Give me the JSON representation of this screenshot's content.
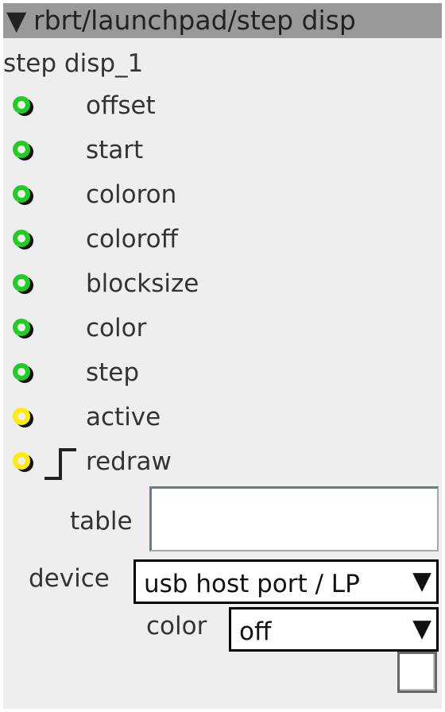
{
  "header": {
    "collapse_glyph": "▼",
    "title": "rbrt/launchpad/step disp"
  },
  "object_name": "step disp_1",
  "ports": [
    {
      "label": "offset",
      "status_color": "#22cc22"
    },
    {
      "label": "start",
      "status_color": "#22cc22"
    },
    {
      "label": "coloron",
      "status_color": "#22cc22"
    },
    {
      "label": "coloroff",
      "status_color": "#22cc22"
    },
    {
      "label": "blocksize",
      "status_color": "#22cc22"
    },
    {
      "label": "color",
      "status_color": "#22cc22"
    },
    {
      "label": "step",
      "status_color": "#22cc22"
    },
    {
      "label": "active",
      "status_color": "#ffee00"
    },
    {
      "label": "redraw",
      "status_color": "#ffee00",
      "icon": "step-function-icon"
    }
  ],
  "params": {
    "table": {
      "label": "table",
      "value": ""
    },
    "device": {
      "label": "device",
      "value": "usb host port / LP",
      "arrow": "▼"
    },
    "color": {
      "label": "color",
      "value": "off",
      "arrow": "▼"
    },
    "checkbox": {
      "checked": false
    }
  }
}
